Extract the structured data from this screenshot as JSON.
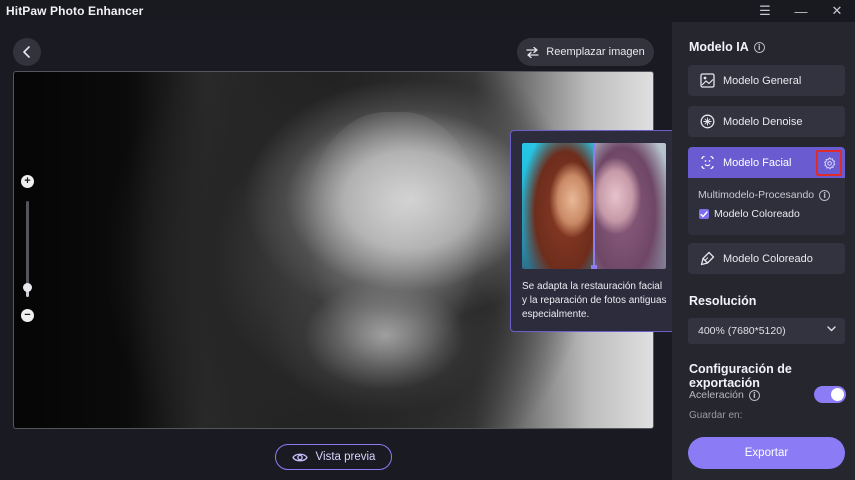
{
  "window": {
    "title": "HitPaw Photo Enhancer",
    "controls": {
      "menu": "☰",
      "minimize": "—",
      "close": "✕"
    }
  },
  "workspace": {
    "replace_label": "Reemplazar imagen",
    "preview_label": "Vista previa",
    "zoom": {
      "plus": "+",
      "minus": "−",
      "level": 0.1
    }
  },
  "tooltip": {
    "text": "Se adapta la restauración facial y la reparación de fotos antiguas especialmente."
  },
  "panel": {
    "model_title": "Modelo IA",
    "info_glyph": "i",
    "models": [
      {
        "label": "Modelo General",
        "icon": "image-icon"
      },
      {
        "label": "Modelo Denoise",
        "icon": "denoise-icon"
      },
      {
        "label": "Modelo Facial",
        "icon": "face-icon",
        "selected": true
      },
      {
        "label": "Modelo Coloreado",
        "icon": "brush-icon"
      }
    ],
    "facial": {
      "multi_label": "Multimodelo-Procesando",
      "checkbox_label": "Modelo Coloreado",
      "checked": true
    },
    "resolution_title": "Resolución",
    "resolution_value": "400% (7680*5120)",
    "export_title": "Configuración de exportación",
    "accel_label": "Aceleración",
    "accel_on": true,
    "save_label": "Guardar en:",
    "export_label": "Exportar"
  },
  "colors": {
    "accent": "#8b7cf6",
    "selected": "#6a5cd0",
    "highlight_box": "#e02b2b",
    "panel_bg": "#26262f"
  }
}
